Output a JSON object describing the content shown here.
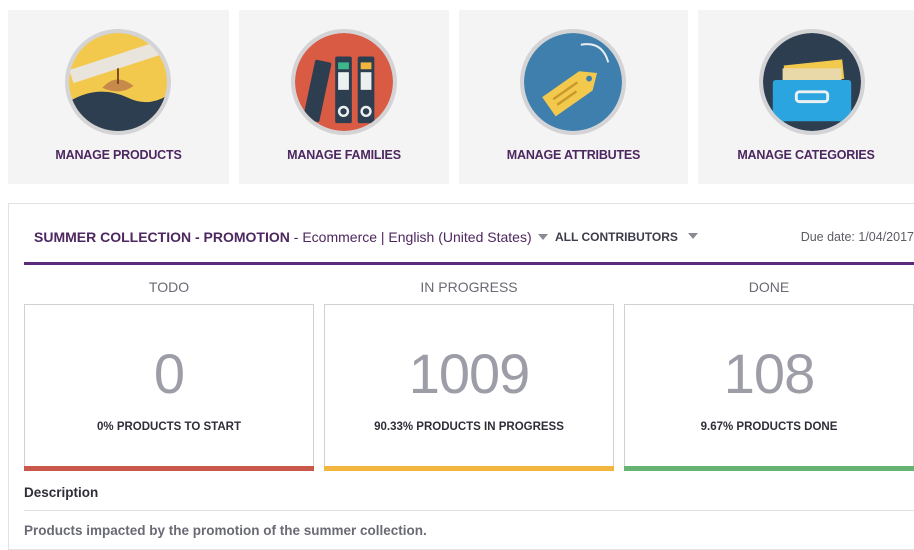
{
  "tiles": [
    {
      "label": "MANAGE PRODUCTS",
      "icon": "product-icon"
    },
    {
      "label": "MANAGE FAMILIES",
      "icon": "binders-icon"
    },
    {
      "label": "MANAGE ATTRIBUTES",
      "icon": "tag-icon"
    },
    {
      "label": "MANAGE CATEGORIES",
      "icon": "drawer-icon"
    }
  ],
  "project": {
    "name": "SUMMER COLLECTION - PROMOTION",
    "context": " - Ecommerce | English (United States)",
    "contributors_filter": "ALL CONTRIBUTORS",
    "due_date": "Due date: 1/04/2017"
  },
  "columns": [
    {
      "title": "TODO",
      "count": "0",
      "caption": "0% PRODUCTS TO START",
      "color": "#c9574a"
    },
    {
      "title": "IN PROGRESS",
      "count": "1009",
      "caption": "90.33% PRODUCTS IN PROGRESS",
      "color": "#f2b53d"
    },
    {
      "title": "DONE",
      "count": "108",
      "caption": "9.67% PRODUCTS DONE",
      "color": "#67b373"
    }
  ],
  "description": {
    "title": "Description",
    "text": "Products impacted by the promotion of the summer collection."
  },
  "colors": {
    "brand": "#5b2a7a",
    "label": "#4d275f"
  }
}
